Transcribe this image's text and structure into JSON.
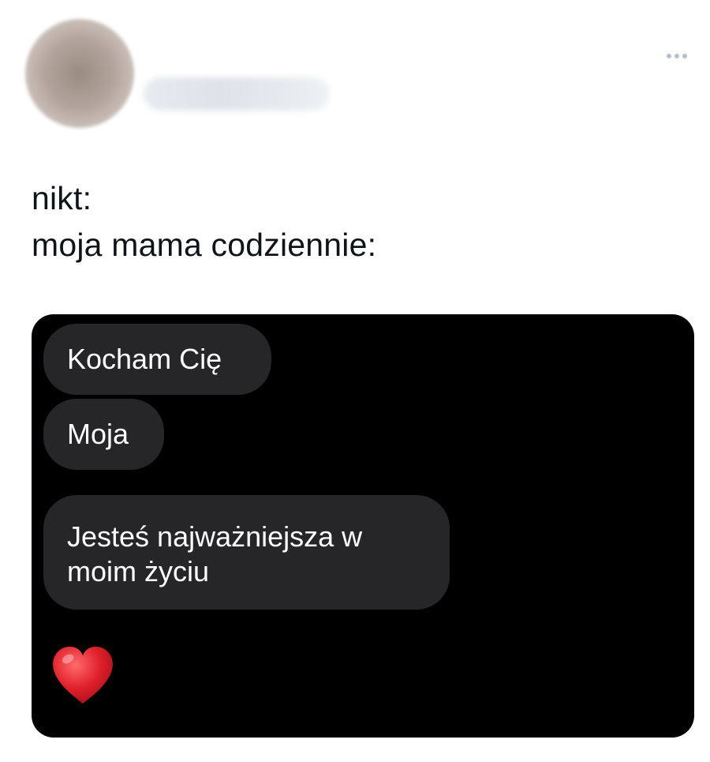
{
  "author": {
    "avatar_icon": "blurred-avatar",
    "name_hidden": true
  },
  "menu": {
    "more_icon": "more-dots-icon"
  },
  "tweet": {
    "line1": "nikt:",
    "line2": "moja mama codziennie:"
  },
  "media": {
    "messages": [
      {
        "text": "Kocham Cię"
      },
      {
        "text": "Moja"
      },
      {
        "line1": "Jesteś najważniejsza w",
        "line2": "moim życiu"
      }
    ],
    "reaction_icon": "red-heart-icon",
    "bubble_color": "#262628",
    "background_color": "#000000"
  }
}
